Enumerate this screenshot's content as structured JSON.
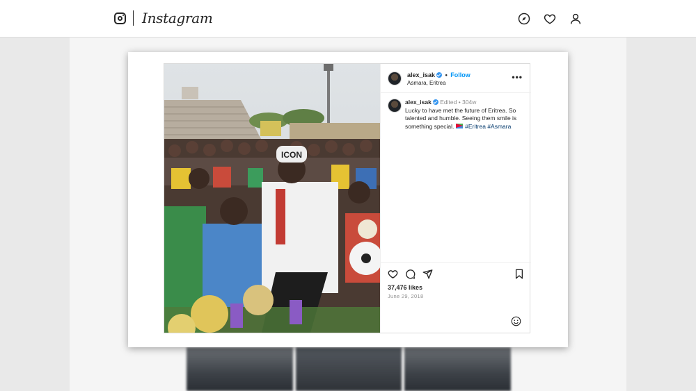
{
  "app": {
    "name": "Instagram"
  },
  "topbar": {
    "logo_icon": "instagram-glyph-icon",
    "nav_icons": [
      "compass-icon",
      "heart-icon",
      "profile-icon"
    ]
  },
  "post": {
    "author": {
      "username": "alex_isak",
      "verified": true,
      "follow_label": "Follow",
      "separator": "•",
      "location": "Asmara, Eritrea"
    },
    "more_icon": "ellipsis-icon",
    "caption": {
      "username": "alex_isak",
      "edited": "Edited",
      "separator": "•",
      "age": "304w",
      "text": "Lucky to have met the future of Eritrea. So talented and humble. Seeing them smile is something special.",
      "flag": "eritrea-flag",
      "hashtags": [
        "#Eritrea",
        "#Asmara"
      ]
    },
    "likes": "37,476 likes",
    "date": "June 29, 2018",
    "action_icons": [
      "heart-icon",
      "comment-icon",
      "share-icon",
      "bookmark-icon",
      "smiley-icon"
    ]
  },
  "colors": {
    "link_blue": "#0095f6",
    "verified_blue": "#3897f0",
    "hashtag": "#00376b",
    "border": "#dbdbdb",
    "muted": "#8e8e8e"
  }
}
